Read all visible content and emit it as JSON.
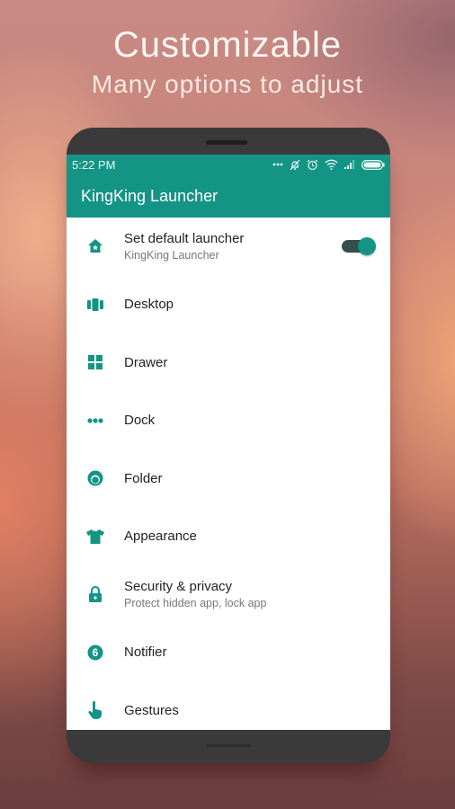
{
  "promo": {
    "headline": "Customizable",
    "subline": "Many options to adjust"
  },
  "colors": {
    "accent": "#149485",
    "toggle_track": "#35504c"
  },
  "statusbar": {
    "time": "5:22 PM",
    "icons": [
      "more-dots-icon",
      "notifications-off-icon",
      "alarm-icon",
      "wifi-icon",
      "signal-icon",
      "battery-icon"
    ]
  },
  "appbar": {
    "title": "KingKing Launcher"
  },
  "settings": {
    "items": [
      {
        "icon": "home-icon",
        "title": "Set default launcher",
        "subtitle": "KingKing Launcher",
        "toggle": true
      },
      {
        "icon": "desktop-pages-icon",
        "title": "Desktop"
      },
      {
        "icon": "grid-icon",
        "title": "Drawer"
      },
      {
        "icon": "dock-dots-icon",
        "title": "Dock"
      },
      {
        "icon": "folder-circle-icon",
        "title": "Folder"
      },
      {
        "icon": "tshirt-icon",
        "title": "Appearance"
      },
      {
        "icon": "lock-icon",
        "title": "Security & privacy",
        "subtitle": "Protect hidden app, lock app"
      },
      {
        "icon": "notifier-badge-icon",
        "title": "Notifier",
        "badge": "6"
      },
      {
        "icon": "hand-pointer-icon",
        "title": "Gestures"
      }
    ]
  }
}
